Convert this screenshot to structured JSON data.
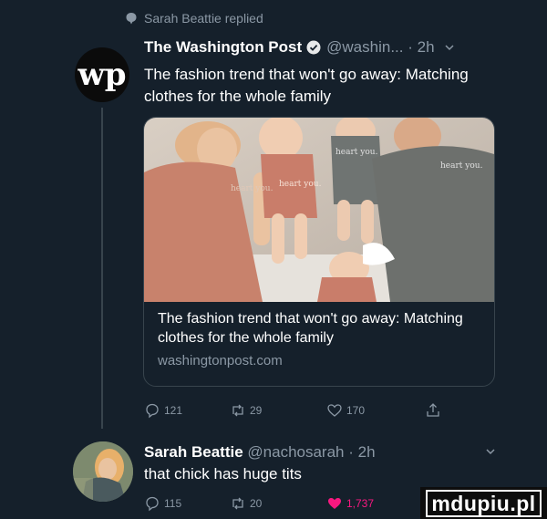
{
  "context": {
    "replied_text": "Sarah Beattie replied"
  },
  "original_tweet": {
    "avatar_glyph": "wp",
    "display_name": "The Washington Post",
    "handle": "@washin...",
    "time": "2h",
    "text": "The fashion trend that won't go away: Matching clothes for the whole family",
    "card": {
      "title": "The fashion trend that won't go away: Matching clothes for the whole family",
      "domain": "washingtonpost.com",
      "photo_shirt_text": [
        "heart you.",
        "heart you.",
        "heart you.",
        "heart you."
      ]
    },
    "actions": {
      "reply_count": "121",
      "retweet_count": "29",
      "like_count": "170"
    }
  },
  "reply_tweet": {
    "display_name": "Sarah Beattie",
    "handle": "@nachosarah",
    "time": "2h",
    "text": "that chick has huge tits",
    "actions": {
      "reply_count": "115",
      "retweet_count": "20",
      "like_count": "1,737"
    }
  },
  "watermark": "mdupiu.pl",
  "colors": {
    "background": "#15202b",
    "muted": "#8b98a5",
    "like_active": "#f91880",
    "verified": "#1d9bf0"
  }
}
